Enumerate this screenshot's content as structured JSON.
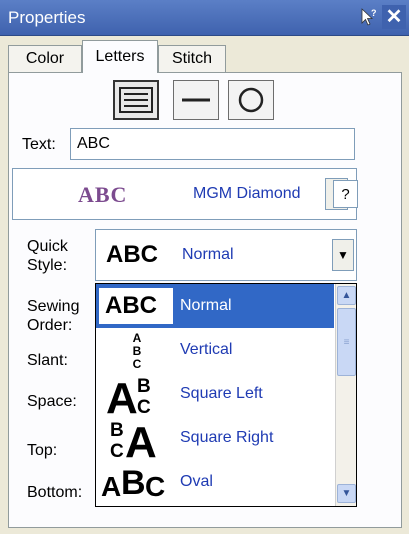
{
  "window": {
    "title": "Properties",
    "help_icon": "help-cursor-icon",
    "close_icon": "close-icon"
  },
  "tabs": [
    {
      "label": "Color"
    },
    {
      "label": "Letters"
    },
    {
      "label": "Stitch"
    }
  ],
  "active_tab": "Letters",
  "shape_buttons": [
    "multi-line-icon",
    "single-line-icon",
    "circle-icon"
  ],
  "selected_shape": "multi-line-icon",
  "text_field": {
    "label": "Text:",
    "value": "ABC"
  },
  "font": {
    "preview": "ABC",
    "name": "MGM Diamond",
    "help_label": "?"
  },
  "quick_style": {
    "label_line1": "Quick",
    "label_line2": "Style:",
    "sample": "ABC",
    "value": "Normal",
    "options": [
      {
        "sample": "ABC",
        "label": "Normal"
      },
      {
        "sample": "ABC",
        "label": "Vertical"
      },
      {
        "sample": "ABC",
        "label": "Square Left"
      },
      {
        "sample": "ABC",
        "label": "Square Right"
      },
      {
        "sample": "ABC",
        "label": "Oval"
      }
    ]
  },
  "labels": {
    "sewing_line1": "Sewing",
    "sewing_line2": "Order:",
    "slant": "Slant:",
    "space": "Space:",
    "top": "Top:",
    "bottom": "Bottom:"
  },
  "colors": {
    "title_bar": "#3f62ae",
    "selection": "#3168c6",
    "option_text": "#1f3bb3",
    "font_preview": "#7c4b8f"
  }
}
